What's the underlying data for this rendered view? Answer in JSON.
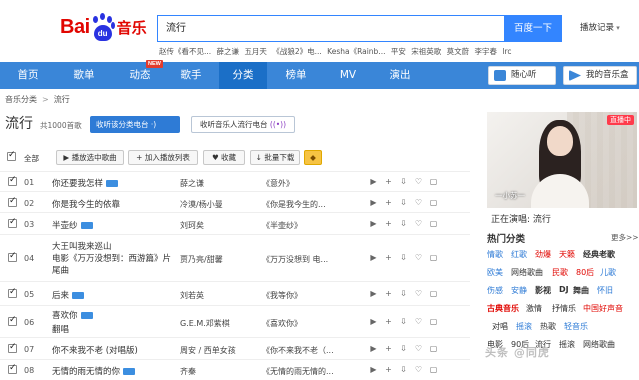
{
  "logo": {
    "bai": "Bai",
    "du": "du",
    "music": "音乐"
  },
  "search": {
    "value": "流行",
    "button": "百度一下",
    "history": "播放记录"
  },
  "hotwords": [
    "赵传《看不见...",
    "薛之谦",
    "五月天",
    "《战狼2》电...",
    "Kesha《Rainb...",
    "平安",
    "宋祖英歌",
    "莫文蔚",
    "李宇春",
    "lrc"
  ],
  "nav": {
    "items": [
      "首页",
      "歌单",
      "动态",
      "歌手",
      "分类",
      "榜单",
      "MV",
      "演出"
    ],
    "new_badge": "NEW",
    "listen_button": "随心听",
    "my_music_button": "我的音乐盒"
  },
  "breadcrumb": [
    "音乐分类",
    "流行"
  ],
  "page": {
    "title": "流行",
    "count": "共1000首歌",
    "radio_button": "收听该分类电台",
    "radio_button2": "收听音乐人流行电台"
  },
  "toolbar": {
    "select_all": "全部",
    "play": "播放选中歌曲",
    "add": "加入播放列表",
    "favorite": "收藏",
    "download": "批量下载"
  },
  "songs": [
    {
      "num": "01",
      "title": "你还要我怎样",
      "sub": "",
      "artist": "薛之谦",
      "album": "《意外》",
      "mv": true
    },
    {
      "num": "02",
      "title": "你是我今生的依靠",
      "sub": "",
      "artist": "冷漠/杨小曼",
      "album": "《你是我今生的...",
      "mv": false
    },
    {
      "num": "03",
      "title": "半壶纱",
      "sub": "",
      "artist": "刘珂矣",
      "album": "《半壶纱》",
      "mv": true
    },
    {
      "num": "04",
      "title": "大王叫我来巡山",
      "sub": "电影《万万没想到：西游篇》片尾曲",
      "artist": "贾乃亮/甜馨",
      "album": "《万万没想到 电...",
      "mv": false
    },
    {
      "num": "05",
      "title": "后来",
      "sub": "",
      "artist": "刘若英",
      "album": "《我等你》",
      "mv": true
    },
    {
      "num": "06",
      "title": "喜欢你",
      "sub": "翻唱",
      "artist": "G.E.M.邓紫棋",
      "album": "《喜欢你》",
      "mv": true
    },
    {
      "num": "07",
      "title": "你不来我不老 (对唱版)",
      "sub": "",
      "artist": "周安 / 西单女孩",
      "album": "《你不来我不老（...",
      "mv": false
    },
    {
      "num": "08",
      "title": "无情的雨无情的你",
      "sub": "",
      "artist": "齐秦",
      "album": "《无情的雨无情的...",
      "mv": true
    }
  ],
  "right": {
    "live_badge": "直播中",
    "live_name": "一小苏一",
    "now_playing": "正在演唱: 流行",
    "hot_title": "热门分类",
    "more": "更多>>",
    "tags": [
      [
        "情歌",
        "红歌",
        "劲爆",
        "天籁",
        "经典老歌"
      ],
      [
        "欧美",
        "网络歌曲",
        "民歌",
        "80后",
        "儿歌"
      ],
      [
        "伤感",
        "安静",
        "影视",
        "DJ",
        "舞曲",
        "怀旧"
      ],
      [
        "古典音乐",
        "激情",
        "抒情乐",
        "中国好声音"
      ],
      [
        "对唱",
        "摇滚",
        "热歌",
        "轻音乐"
      ],
      [
        "电影",
        "90后",
        "流行",
        "摇滚",
        "网络歌曲"
      ]
    ]
  },
  "colors": {
    "nav": "#3a86d8",
    "accent_red": "#e10601",
    "link_blue": "#2e7bd6"
  },
  "watermark": "头条 @同虎"
}
